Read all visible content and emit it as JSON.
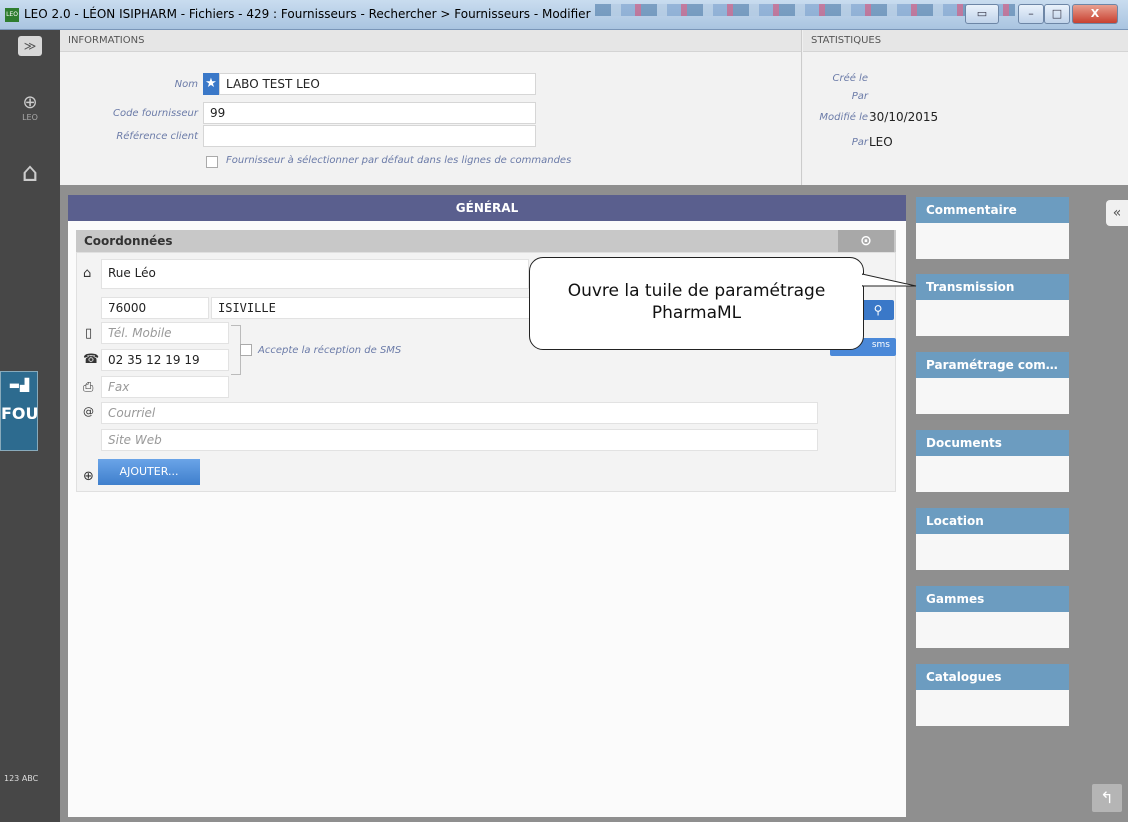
{
  "window": {
    "title": "LEO 2.0 - LÉON ISIPHARM - Fichiers - 429 : Fournisseurs - Rechercher > Fournisseurs - Modifier",
    "close_label": "X"
  },
  "leftbar": {
    "leo_label": "LEO",
    "module_label": "FOU",
    "bottom_label": "123 ABC"
  },
  "informations": {
    "header": "INFORMATIONS",
    "nom_label": "Nom",
    "nom_value": "LABO TEST LEO",
    "code_label": "Code fournisseur",
    "code_value": "99",
    "ref_label": "Référence client",
    "ref_value": "",
    "default_checkbox_label": "Fournisseur à sélectionner par défaut dans les lignes de commandes"
  },
  "statistiques": {
    "header": "STATISTIQUES",
    "cree_le_label": "Créé le",
    "cree_par_label": "Par",
    "modifie_le_label": "Modifié le",
    "modifie_le_value": "30/10/2015",
    "modifie_par_label": "Par",
    "modifie_par_value": "LEO"
  },
  "general": {
    "title": "GÉNÉRAL",
    "coords_title": "Coordonnées",
    "address": "Rue Léo",
    "postcode": "76000",
    "city": "ISIVILLE",
    "mobile_placeholder": "Tél. Mobile",
    "phone": "02 35 12 19 19",
    "sms_label": "Accepte la réception de SMS",
    "fax_placeholder": "Fax",
    "email_placeholder": "Courriel",
    "web_placeholder": "Site Web",
    "add_button": "AJOUTER...",
    "sms_button": "sms"
  },
  "tiles": [
    "Commentaire",
    "Transmission",
    "Paramétrage comm...",
    "Documents",
    "Location",
    "Gammes",
    "Catalogues"
  ],
  "tooltip": {
    "line1": "Ouvre la tuile de paramétrage",
    "line2": "PharmaML"
  },
  "colors": {
    "panel_header": "#5a5f8e",
    "tile_header": "#6c9cc0",
    "accent_blue": "#3a78c8",
    "leftbar": "#474747"
  }
}
